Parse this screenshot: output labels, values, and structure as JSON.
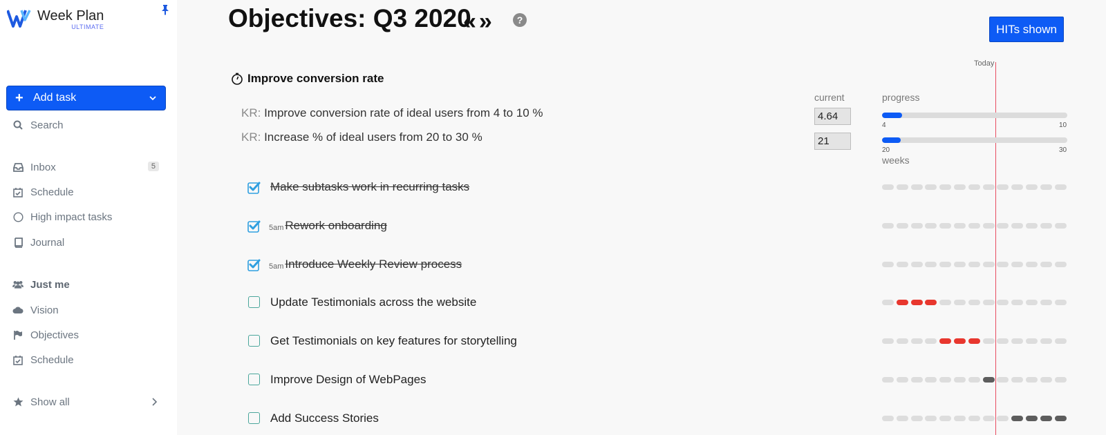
{
  "app": {
    "name": "Week Plan",
    "tier": "ULTIMATE"
  },
  "sidebar": {
    "add_task": "Add task",
    "search": "Search",
    "items": [
      {
        "label": "Inbox",
        "icon": "inbox-icon",
        "badge": "5"
      },
      {
        "label": "Schedule",
        "icon": "calendar-check-icon"
      },
      {
        "label": "High impact tasks",
        "icon": "circle-icon"
      },
      {
        "label": "Journal",
        "icon": "book-icon"
      }
    ],
    "group": {
      "label": "Just me",
      "icon": "users-icon"
    },
    "group_items": [
      {
        "label": "Vision",
        "icon": "cloud-icon"
      },
      {
        "label": "Objectives",
        "icon": "flag-icon"
      },
      {
        "label": "Schedule",
        "icon": "calendar-check-icon"
      }
    ],
    "show_all": "Show all"
  },
  "header": {
    "title": "Objectives: Q3 2020",
    "prev": "«",
    "next": "»",
    "help": "?",
    "hits_button": "HITs shown"
  },
  "timeline": {
    "today_label": "Today",
    "weeks_label": "weeks"
  },
  "objective": {
    "title": "Improve conversion rate",
    "current_label": "current",
    "progress_label": "progress",
    "key_results": [
      {
        "prefix": "KR:",
        "text": "Improve conversion rate of ideal users from 4 to 10 %",
        "current": "4.64",
        "min": "4",
        "max": "10",
        "progress": 0.107
      },
      {
        "prefix": "KR:",
        "text": "Increase % of ideal users from 20 to 30 %",
        "current": "21",
        "min": "20",
        "max": "30",
        "progress": 0.1
      }
    ],
    "tasks": [
      {
        "text": "Make subtasks work in recurring tasks",
        "done": true,
        "time": "",
        "weeks": [
          "",
          "",
          "",
          "",
          "",
          "",
          "",
          "",
          "",
          "",
          "",
          "",
          ""
        ]
      },
      {
        "text": "Rework onboarding",
        "done": true,
        "time": "5am",
        "weeks": [
          "",
          "",
          "",
          "",
          "",
          "",
          "",
          "",
          "",
          "",
          "",
          "",
          ""
        ]
      },
      {
        "text": "Introduce Weekly Review process",
        "done": true,
        "time": "5am",
        "weeks": [
          "",
          "",
          "",
          "",
          "",
          "",
          "",
          "",
          "",
          "",
          "",
          "",
          ""
        ]
      },
      {
        "text": "Update Testimonials across the website",
        "done": false,
        "time": "",
        "weeks": [
          "",
          "red",
          "red",
          "red",
          "",
          "",
          "",
          "",
          "",
          "",
          "",
          "",
          ""
        ]
      },
      {
        "text": "Get Testimonials on key features for storytelling",
        "done": false,
        "time": "",
        "weeks": [
          "",
          "",
          "",
          "",
          "red",
          "red",
          "red",
          "",
          "",
          "",
          "",
          "",
          ""
        ]
      },
      {
        "text": "Improve Design of WebPages",
        "done": false,
        "time": "",
        "weeks": [
          "",
          "",
          "",
          "",
          "",
          "",
          "",
          "dark",
          "",
          "",
          "",
          "",
          ""
        ]
      },
      {
        "text": "Add Success Stories",
        "done": false,
        "time": "",
        "weeks": [
          "",
          "",
          "",
          "",
          "",
          "",
          "",
          "",
          "",
          "dark",
          "dark",
          "dark",
          "dark"
        ]
      }
    ]
  },
  "colors": {
    "accent": "#0d5bf5",
    "today_line": "#e84a5f",
    "overdue": "#e8372e",
    "scheduled": "#5d5d5d",
    "checkbox_done": "#2f9fe0"
  }
}
